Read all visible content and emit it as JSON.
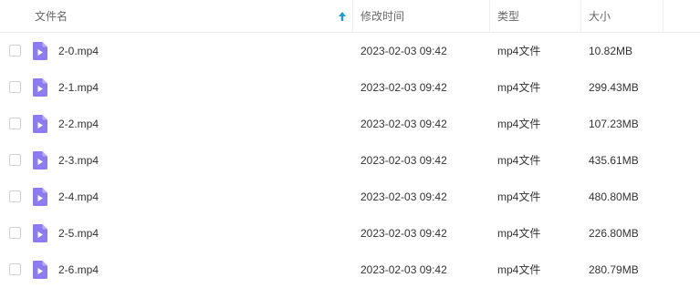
{
  "header": {
    "name_label": "文件名",
    "modified_label": "修改时间",
    "type_label": "类型",
    "size_label": "大小",
    "sort_icon": "sort-up-arrow-icon",
    "accent_color": "#1a9bdb"
  },
  "file_icon": "video-file-icon",
  "file_icon_color": "#8c7cf0",
  "files": [
    {
      "name": "2-0.mp4",
      "modified": "2023-02-03 09:42",
      "type": "mp4文件",
      "size": "10.82MB"
    },
    {
      "name": "2-1.mp4",
      "modified": "2023-02-03 09:42",
      "type": "mp4文件",
      "size": "299.43MB"
    },
    {
      "name": "2-2.mp4",
      "modified": "2023-02-03 09:42",
      "type": "mp4文件",
      "size": "107.23MB"
    },
    {
      "name": "2-3.mp4",
      "modified": "2023-02-03 09:42",
      "type": "mp4文件",
      "size": "435.61MB"
    },
    {
      "name": "2-4.mp4",
      "modified": "2023-02-03 09:42",
      "type": "mp4文件",
      "size": "480.80MB"
    },
    {
      "name": "2-5.mp4",
      "modified": "2023-02-03 09:42",
      "type": "mp4文件",
      "size": "226.80MB"
    },
    {
      "name": "2-6.mp4",
      "modified": "2023-02-03 09:42",
      "type": "mp4文件",
      "size": "280.79MB"
    }
  ]
}
